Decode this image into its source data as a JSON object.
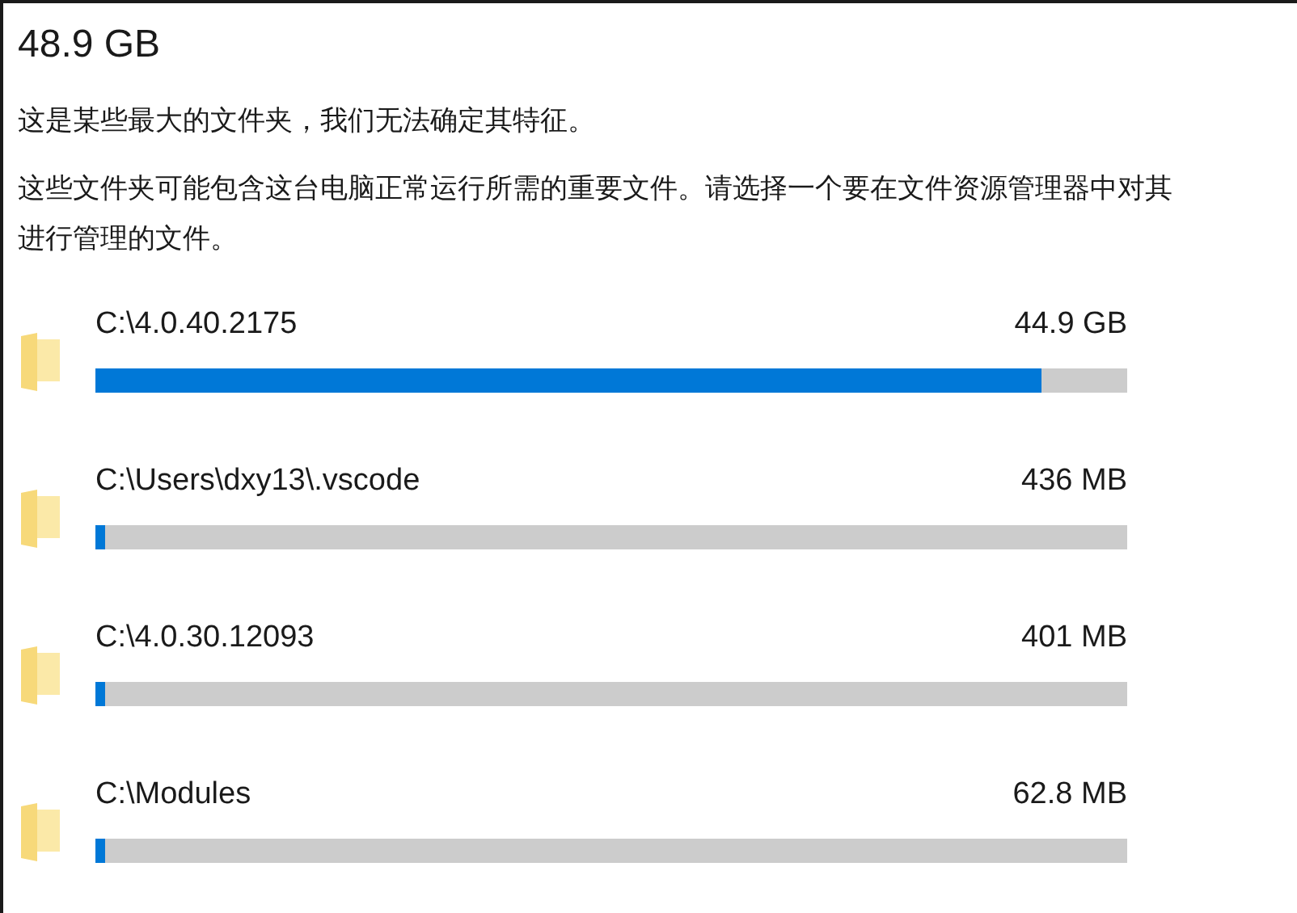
{
  "title": "48.9 GB",
  "description": "这是某些最大的文件夹，我们无法确定其特征。",
  "note": "这些文件夹可能包含这台电脑正常运行所需的重要文件。请选择一个要在文件资源管理器中对其进行管理的文件。",
  "folders": [
    {
      "path": "C:\\4.0.40.2175",
      "size": "44.9 GB",
      "level": 0.917
    },
    {
      "path": "C:\\Users\\dxy13\\.vscode",
      "size": "436 MB",
      "level": 0.01
    },
    {
      "path": "C:\\4.0.30.12093",
      "size": "401 MB",
      "level": 0.01
    },
    {
      "path": "C:\\Modules",
      "size": "62.8 MB",
      "level": 0.01
    }
  ]
}
